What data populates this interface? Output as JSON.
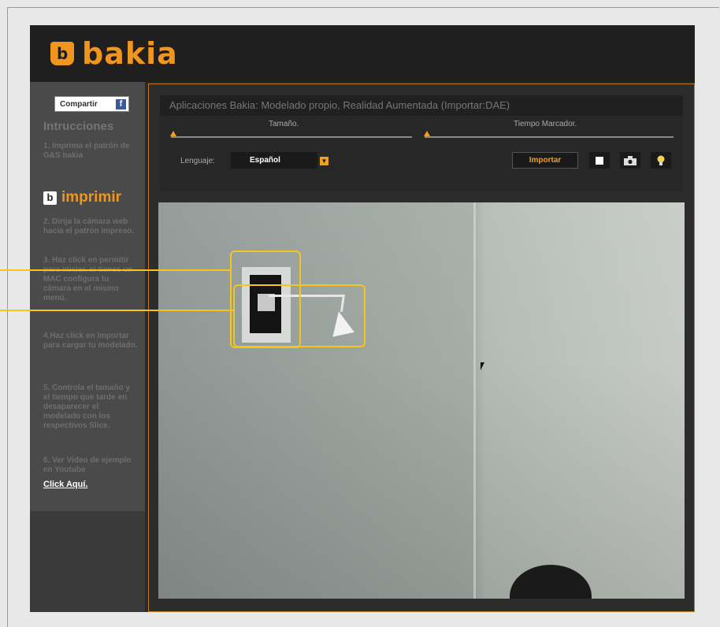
{
  "brand": {
    "name": "bakia",
    "color": "#f0961e"
  },
  "sidebar": {
    "share_label": "Compartir",
    "share_icon": "f",
    "instructions_title": "Intrucciones",
    "steps": [
      "1. Imprima el patrón de G&S bakia",
      "2. Dirija la cámara web hacia el patrón impreso.",
      "3. Haz click en permitir para iniciar, si tienes un MAC configura tu cámara en el mismo menú.",
      "4.Haz click en importar para cargar tu modelado.",
      "5. Controla el tamaño y el tiempo que tarde en desaparecer el modelado con los respectivos Slice.",
      "6. Ver Video de ejemplo en Youtube"
    ],
    "print_label": "imprimir",
    "print_icon": "b",
    "click_link": "Click Aquí."
  },
  "app": {
    "title": "Aplicaciones Bakia: Modelado propio, Realidad Aumentada (Importar:DAE)",
    "size_label": "Tamaño.",
    "marker_time_label": "Tiempo Marcador.",
    "size_value": 0.0,
    "marker_time_value": 0.0,
    "language_label": "Lenguaje:",
    "language_value": "Español",
    "import_label": "Importar",
    "icons": [
      "square-icon",
      "camera-icon",
      "lightbulb-icon"
    ]
  },
  "annotation_color": "#f5c518"
}
